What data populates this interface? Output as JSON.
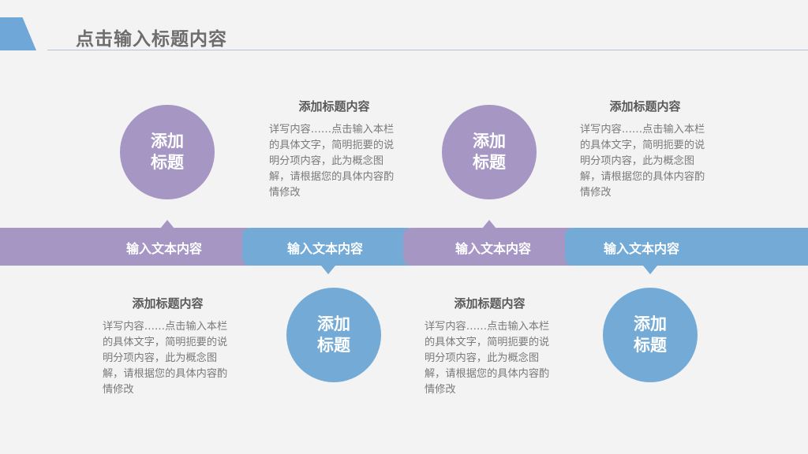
{
  "header": {
    "title": "点击输入标题内容"
  },
  "colors": {
    "purple": "#a596c4",
    "blue": "#73aad6",
    "title": "#6d6d6d"
  },
  "band": {
    "segments": [
      {
        "label": "输入文本内容",
        "color": "purple"
      },
      {
        "label": "输入文本内容",
        "color": "blue"
      },
      {
        "label": "输入文本内容",
        "color": "purple"
      },
      {
        "label": "输入文本内容",
        "color": "blue"
      }
    ]
  },
  "items": [
    {
      "circle_label": "添加标题",
      "heading": "添加标题内容",
      "description": "详写内容……点击输入本栏的具体文字，简明扼要的说明分项内容，此为概念图解，请根据您的具体内容酌情修改"
    },
    {
      "circle_label": "添加标题",
      "heading": "添加标题内容",
      "description": "详写内容……点击输入本栏的具体文字，简明扼要的说明分项内容，此为概念图解，请根据您的具体内容酌情修改"
    },
    {
      "circle_label": "添加标题",
      "heading": "添加标题内容",
      "description": "详写内容……点击输入本栏的具体文字，简明扼要的说明分项内容，此为概念图解，请根据您的具体内容酌情修改"
    },
    {
      "circle_label": "添加标题",
      "heading": "添加标题内容",
      "description": "详写内容……点击输入本栏的具体文字，简明扼要的说明分项内容，此为概念图解，请根据您的具体内容酌情修改"
    }
  ]
}
